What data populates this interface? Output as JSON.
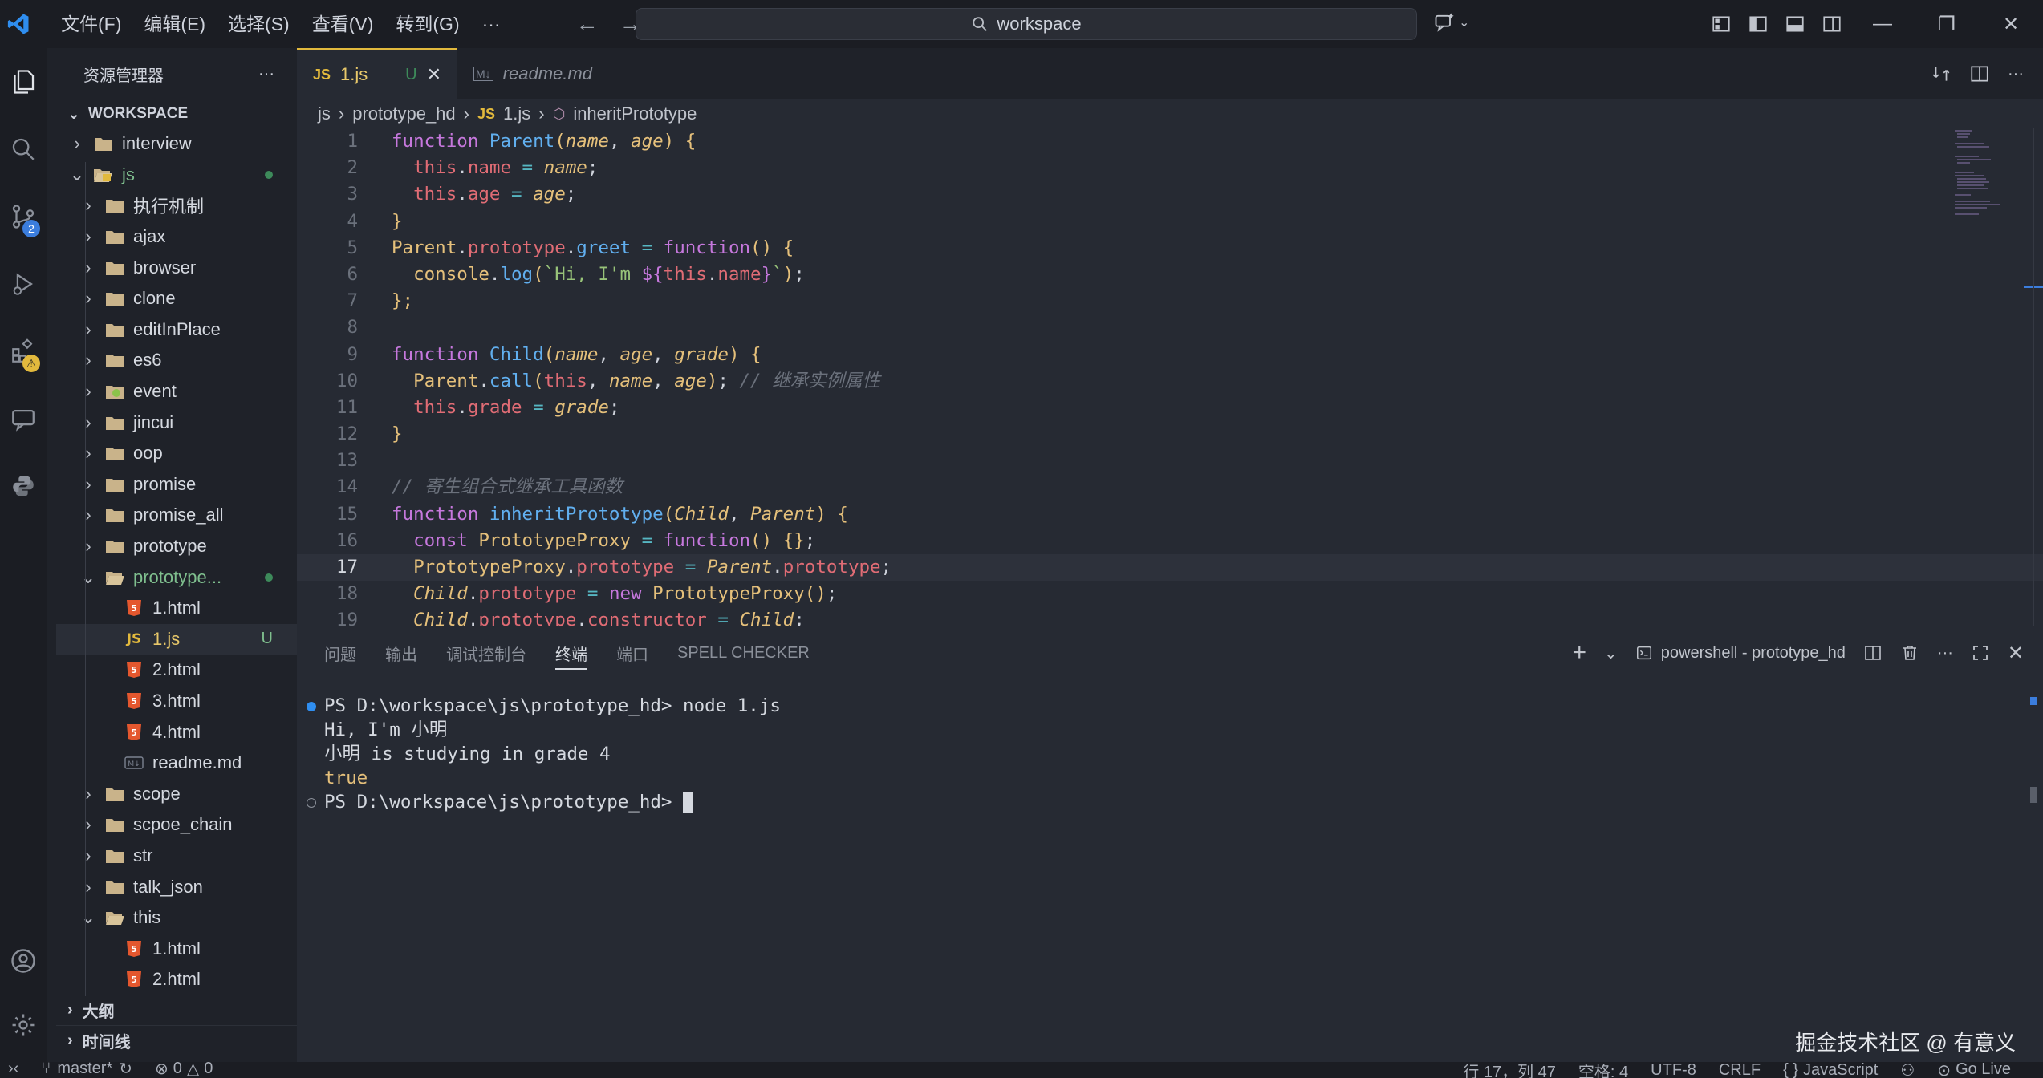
{
  "titlebar": {
    "menus": [
      "文件(F)",
      "编辑(E)",
      "选择(S)",
      "查看(V)",
      "转到(G)",
      "···"
    ],
    "search_text": "workspace"
  },
  "activity": {
    "source_control_badge": "2",
    "extensions_badge": "⚠"
  },
  "sidebar": {
    "title": "资源管理器",
    "more": "···",
    "workspace": "WORKSPACE",
    "tree": [
      {
        "label": "interview",
        "depth": 1,
        "type": "folder",
        "open": false
      },
      {
        "label": "js",
        "depth": 1,
        "type": "folder-js",
        "open": true,
        "dot": true
      },
      {
        "label": "执行机制",
        "depth": 2,
        "type": "folder",
        "open": false
      },
      {
        "label": "ajax",
        "depth": 2,
        "type": "folder",
        "open": false
      },
      {
        "label": "browser",
        "depth": 2,
        "type": "folder",
        "open": false
      },
      {
        "label": "clone",
        "depth": 2,
        "type": "folder",
        "open": false
      },
      {
        "label": "editInPlace",
        "depth": 2,
        "type": "folder",
        "open": false
      },
      {
        "label": "es6",
        "depth": 2,
        "type": "folder",
        "open": false
      },
      {
        "label": "event",
        "depth": 2,
        "type": "folder-event",
        "open": false
      },
      {
        "label": "jincui",
        "depth": 2,
        "type": "folder",
        "open": false
      },
      {
        "label": "oop",
        "depth": 2,
        "type": "folder",
        "open": false
      },
      {
        "label": "promise",
        "depth": 2,
        "type": "folder",
        "open": false
      },
      {
        "label": "promise_all",
        "depth": 2,
        "type": "folder",
        "open": false
      },
      {
        "label": "prototype",
        "depth": 2,
        "type": "folder",
        "open": false
      },
      {
        "label": "prototype...",
        "depth": 2,
        "type": "folder",
        "open": true,
        "dot": true,
        "green": true
      },
      {
        "label": "1.html",
        "depth": 3,
        "type": "html"
      },
      {
        "label": "1.js",
        "depth": 3,
        "type": "js",
        "selected": true,
        "status": "U"
      },
      {
        "label": "2.html",
        "depth": 3,
        "type": "html"
      },
      {
        "label": "3.html",
        "depth": 3,
        "type": "html"
      },
      {
        "label": "4.html",
        "depth": 3,
        "type": "html"
      },
      {
        "label": "readme.md",
        "depth": 3,
        "type": "md"
      },
      {
        "label": "scope",
        "depth": 2,
        "type": "folder",
        "open": false
      },
      {
        "label": "scpoe_chain",
        "depth": 2,
        "type": "folder",
        "open": false
      },
      {
        "label": "str",
        "depth": 2,
        "type": "folder",
        "open": false
      },
      {
        "label": "talk_json",
        "depth": 2,
        "type": "folder",
        "open": false
      },
      {
        "label": "this",
        "depth": 2,
        "type": "folder",
        "open": true
      },
      {
        "label": "1.html",
        "depth": 3,
        "type": "html"
      },
      {
        "label": "2.html",
        "depth": 3,
        "type": "html"
      }
    ],
    "outline": "大纲",
    "timeline": "时间线"
  },
  "editor": {
    "tabs": [
      {
        "icon": "JS",
        "label": "1.js",
        "status": "U",
        "close": "✕"
      },
      {
        "icon": "M↓",
        "label": "readme.md"
      }
    ],
    "breadcrumb": [
      "js",
      "prototype_hd",
      "1.js",
      "inheritPrototype"
    ],
    "breadcrumb_file_icon": "JS",
    "current_line": 17,
    "lines": [
      [
        [
          "k",
          "function "
        ],
        [
          "f",
          "Parent"
        ],
        [
          "b",
          "("
        ],
        [
          "p",
          "name"
        ],
        [
          "d",
          ", "
        ],
        [
          "p",
          "age"
        ],
        [
          "b",
          ") {"
        ]
      ],
      [
        [
          "d",
          "  "
        ],
        [
          "v",
          "this"
        ],
        [
          "d",
          "."
        ],
        [
          "v",
          "name"
        ],
        [
          "o",
          " = "
        ],
        [
          "p",
          "name"
        ],
        [
          "d",
          ";"
        ]
      ],
      [
        [
          "d",
          "  "
        ],
        [
          "v",
          "this"
        ],
        [
          "d",
          "."
        ],
        [
          "v",
          "age"
        ],
        [
          "o",
          " = "
        ],
        [
          "p",
          "age"
        ],
        [
          "d",
          ";"
        ]
      ],
      [
        [
          "b",
          "}"
        ]
      ],
      [
        [
          "t",
          "Parent"
        ],
        [
          "d",
          "."
        ],
        [
          "v",
          "prototype"
        ],
        [
          "d",
          "."
        ],
        [
          "f",
          "greet"
        ],
        [
          "o",
          " = "
        ],
        [
          "k",
          "function"
        ],
        [
          "b",
          "() {"
        ]
      ],
      [
        [
          "d",
          "  "
        ],
        [
          "t",
          "console"
        ],
        [
          "d",
          "."
        ],
        [
          "f",
          "log"
        ],
        [
          "b",
          "("
        ],
        [
          "s",
          "`Hi, I'm "
        ],
        [
          "k",
          "${"
        ],
        [
          "v",
          "this"
        ],
        [
          "d",
          "."
        ],
        [
          "v",
          "name"
        ],
        [
          "k",
          "}"
        ],
        [
          "s",
          "`"
        ],
        [
          "b",
          ")"
        ],
        [
          "d",
          ";"
        ]
      ],
      [
        [
          "b",
          "};"
        ]
      ],
      [],
      [
        [
          "k",
          "function "
        ],
        [
          "f",
          "Child"
        ],
        [
          "b",
          "("
        ],
        [
          "p",
          "name"
        ],
        [
          "d",
          ", "
        ],
        [
          "p",
          "age"
        ],
        [
          "d",
          ", "
        ],
        [
          "p",
          "grade"
        ],
        [
          "b",
          ") {"
        ]
      ],
      [
        [
          "d",
          "  "
        ],
        [
          "t",
          "Parent"
        ],
        [
          "d",
          "."
        ],
        [
          "f",
          "call"
        ],
        [
          "b",
          "("
        ],
        [
          "v",
          "this"
        ],
        [
          "d",
          ", "
        ],
        [
          "p",
          "name"
        ],
        [
          "d",
          ", "
        ],
        [
          "p",
          "age"
        ],
        [
          "b",
          ")"
        ],
        [
          "d",
          "; "
        ],
        [
          "c",
          "// 继承实例属性"
        ]
      ],
      [
        [
          "d",
          "  "
        ],
        [
          "v",
          "this"
        ],
        [
          "d",
          "."
        ],
        [
          "v",
          "grade"
        ],
        [
          "o",
          " = "
        ],
        [
          "p",
          "grade"
        ],
        [
          "d",
          ";"
        ]
      ],
      [
        [
          "b",
          "}"
        ]
      ],
      [],
      [
        [
          "c",
          "// 寄生组合式继承工具函数"
        ]
      ],
      [
        [
          "k",
          "function "
        ],
        [
          "f",
          "inheritPrototype"
        ],
        [
          "b",
          "("
        ],
        [
          "p",
          "Child"
        ],
        [
          "d",
          ", "
        ],
        [
          "p",
          "Parent"
        ],
        [
          "b",
          ") {"
        ]
      ],
      [
        [
          "d",
          "  "
        ],
        [
          "k",
          "const "
        ],
        [
          "t",
          "PrototypeProxy"
        ],
        [
          "o",
          " = "
        ],
        [
          "k",
          "function"
        ],
        [
          "b",
          "() {}"
        ],
        [
          "d",
          ";"
        ]
      ],
      [
        [
          "d",
          "  "
        ],
        [
          "t",
          "PrototypeProxy"
        ],
        [
          "d",
          "."
        ],
        [
          "v",
          "prototype"
        ],
        [
          "o",
          " = "
        ],
        [
          "p",
          "Parent"
        ],
        [
          "d",
          "."
        ],
        [
          "v",
          "prototype"
        ],
        [
          "d",
          ";"
        ]
      ],
      [
        [
          "d",
          "  "
        ],
        [
          "p",
          "Child"
        ],
        [
          "d",
          "."
        ],
        [
          "v",
          "prototype"
        ],
        [
          "o",
          " = "
        ],
        [
          "k",
          "new "
        ],
        [
          "t",
          "PrototypeProxy"
        ],
        [
          "b",
          "()"
        ],
        [
          "d",
          ";"
        ]
      ],
      [
        [
          "d",
          "  "
        ],
        [
          "p",
          "Child"
        ],
        [
          "d",
          "."
        ],
        [
          "v",
          "prototype"
        ],
        [
          "d",
          "."
        ],
        [
          "v",
          "constructor"
        ],
        [
          "o",
          " = "
        ],
        [
          "p",
          "Child"
        ],
        [
          "d",
          ";"
        ]
      ]
    ]
  },
  "panel": {
    "tabs": [
      "问题",
      "输出",
      "调试控制台",
      "终端",
      "端口",
      "SPELL CHECKER"
    ],
    "active_tab": "终端",
    "terminal_name": "powershell - prototype_hd",
    "add": "+",
    "more": "···",
    "terminal": {
      "prompt1": "PS D:\\workspace\\js\\prototype_hd> ",
      "command": "node 1.js",
      "output": [
        "Hi, I'm 小明",
        "小明 is studying in grade 4"
      ],
      "result": "true",
      "prompt2": "PS D:\\workspace\\js\\prototype_hd> "
    }
  },
  "status": {
    "branch": "master*",
    "errors": "0",
    "warnings": "0",
    "position": "行 17，列 47",
    "spaces": "空格: 4",
    "encoding": "UTF-8",
    "eol": "CRLF",
    "language": "JavaScript",
    "golive": "Go Live"
  },
  "watermark": "掘金技术社区 @ 有意义",
  "colors": {
    "accent": "#3b7ddd",
    "js_yellow": "#e2b93d",
    "html_orange": "#e4572e",
    "folder": "#c9b38a",
    "git_green": "#3d8a5a"
  }
}
